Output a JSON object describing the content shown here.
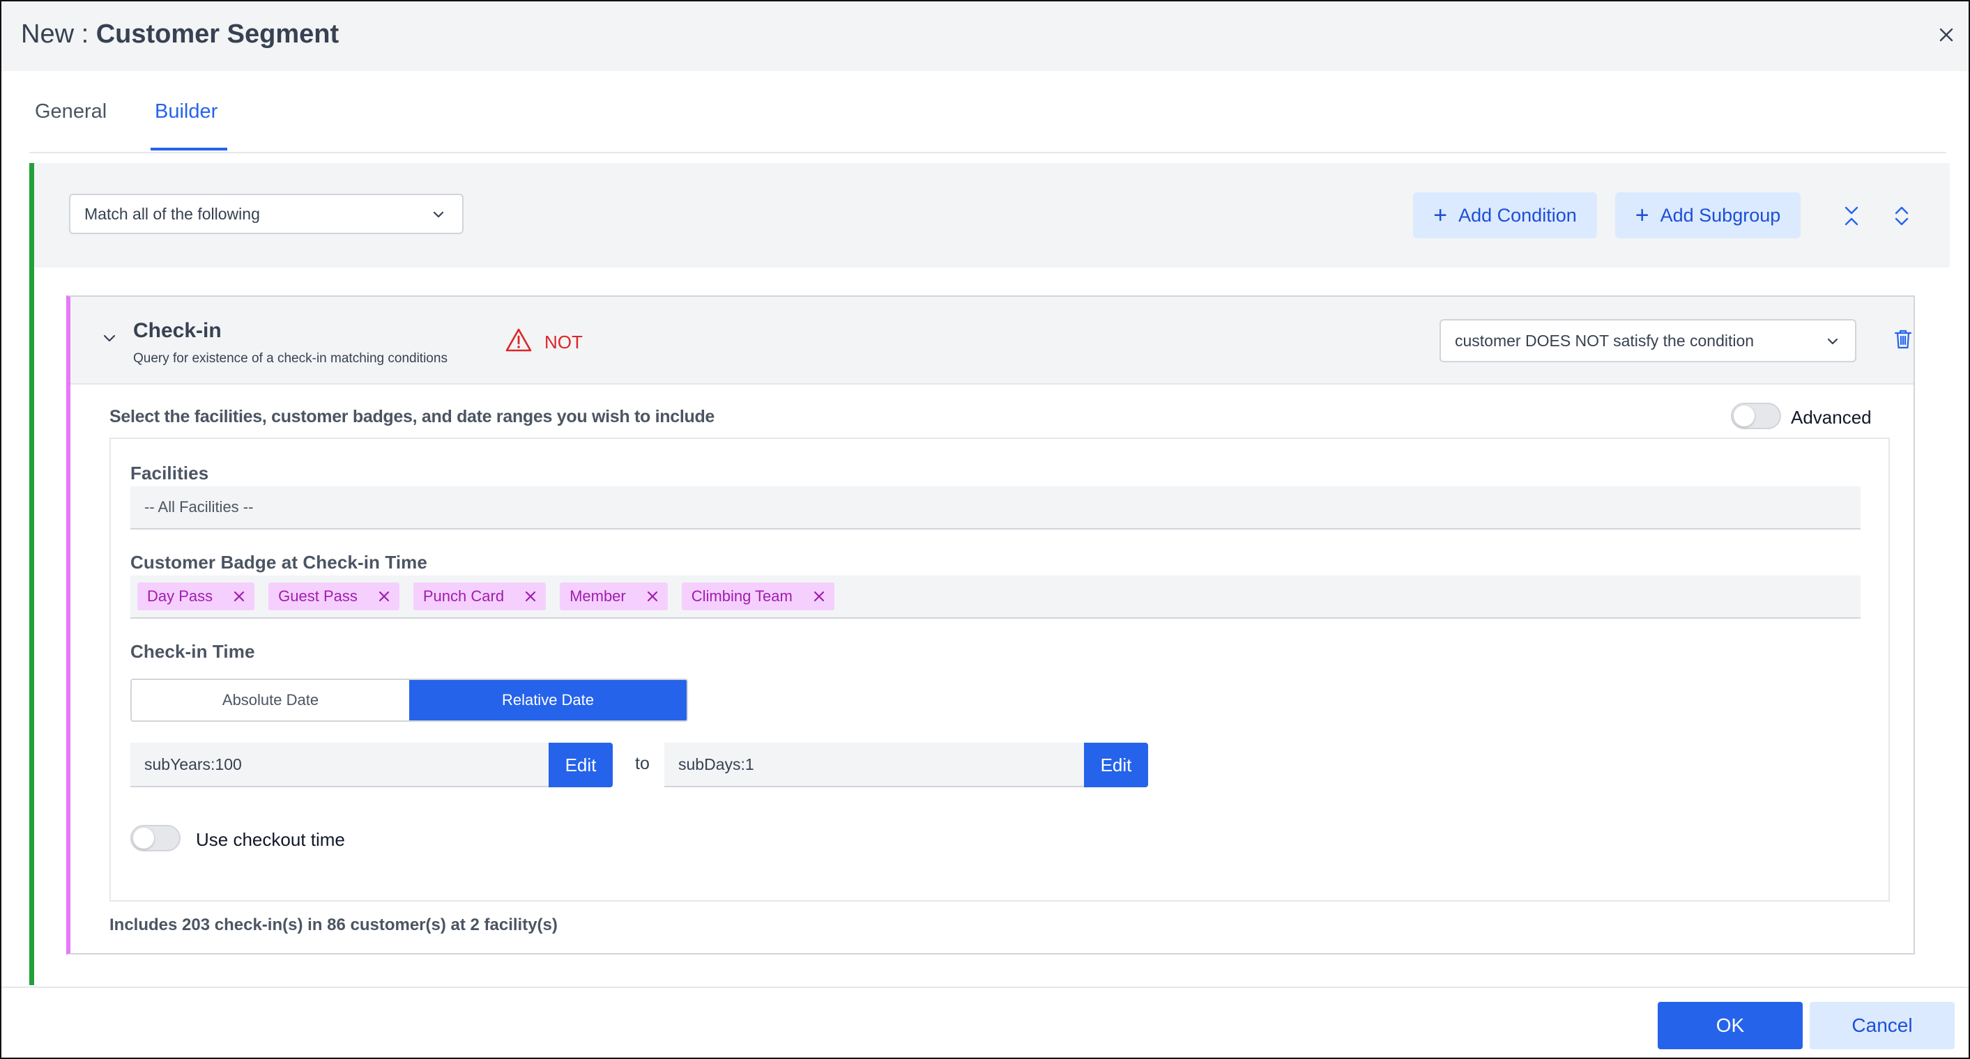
{
  "dialog": {
    "title_prefix": "New :",
    "title_name": "Customer Segment",
    "close_icon": "close-icon"
  },
  "tabs": [
    {
      "label": "General",
      "active": false
    },
    {
      "label": "Builder",
      "active": true
    }
  ],
  "group": {
    "match_select": "Match all of the following",
    "add_condition": "Add Condition",
    "add_subgroup": "Add Subgroup",
    "accent_color": "#22a03a"
  },
  "condition": {
    "title": "Check-in",
    "subtitle": "Query for existence of a check-in matching conditions",
    "not_label": "NOT",
    "satisfy_select": "customer DOES NOT satisfy the condition",
    "instruction": "Select the facilities, customer badges, and date ranges you wish to include",
    "advanced_label": "Advanced",
    "advanced_on": false,
    "accent_color": "#e879f9",
    "facilities_label": "Facilities",
    "facilities_value": "-- All Facilities --",
    "badge_label": "Customer Badge at Check-in Time",
    "badges": [
      "Day Pass",
      "Guest Pass",
      "Punch Card",
      "Member",
      "Climbing Team"
    ],
    "checkin_time_label": "Check-in Time",
    "date_modes": [
      "Absolute Date",
      "Relative Date"
    ],
    "selected_date_mode": "Relative Date",
    "from_value": "subYears:100",
    "to_word": "to",
    "to_value": "subDays:1",
    "edit_label": "Edit",
    "checkout_label": "Use checkout time",
    "checkout_on": false,
    "summary": "Includes 203 check-in(s) in 86 customer(s) at 2 facility(s)"
  },
  "footer": {
    "ok": "OK",
    "cancel": "Cancel"
  },
  "colors": {
    "primary": "#2563eb",
    "danger": "#dc2626",
    "chip_bg": "#f5d0fe",
    "chip_text": "#a21caf"
  }
}
